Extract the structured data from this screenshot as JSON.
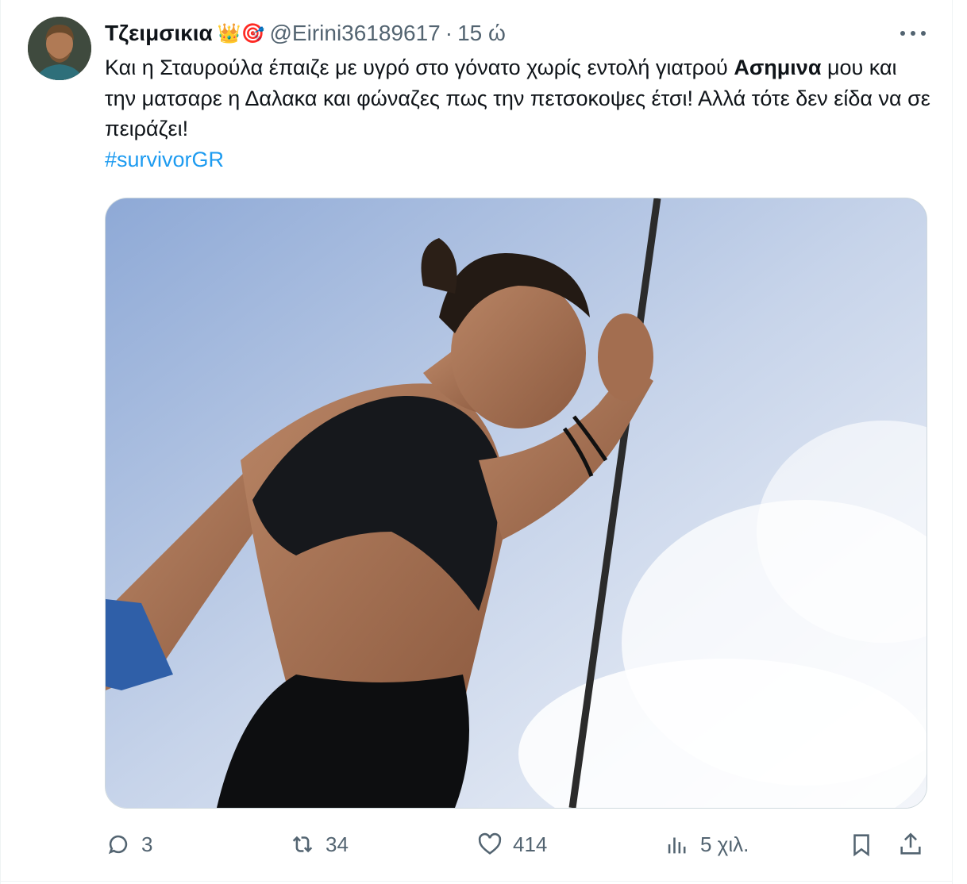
{
  "tweet": {
    "display_name": "Τζειμσικια",
    "name_emojis": "👑🎯",
    "handle": "@Eirini36189617",
    "separator": "·",
    "time": "15 ώ",
    "text_before_mention": "Και η Σταυρούλα έπαιζε με υγρό στο γόνατο χωρίς εντολή γιατρού ",
    "mention_name": "Ασημινα",
    "text_after_mention": " μου και την ματσαρε η Δαλακα και φώναζες πως την πετσοκοψες έτσι! Αλλά τότε δεν είδα να σε πειράζει!",
    "hashtag": "#survivorGR",
    "media_icon": "photo"
  },
  "actions": {
    "replies": "3",
    "reposts": "34",
    "likes": "414",
    "views": "5 χιλ.",
    "reply_icon": "reply-icon",
    "repost_icon": "repost-icon",
    "like_icon": "heart-icon",
    "views_icon": "views-icon",
    "bookmark_icon": "bookmark-icon",
    "share_icon": "share-icon"
  },
  "colors": {
    "text": "#0f1419",
    "secondary": "#536471",
    "link": "#1d9bf0",
    "border": "#cfd9de"
  }
}
